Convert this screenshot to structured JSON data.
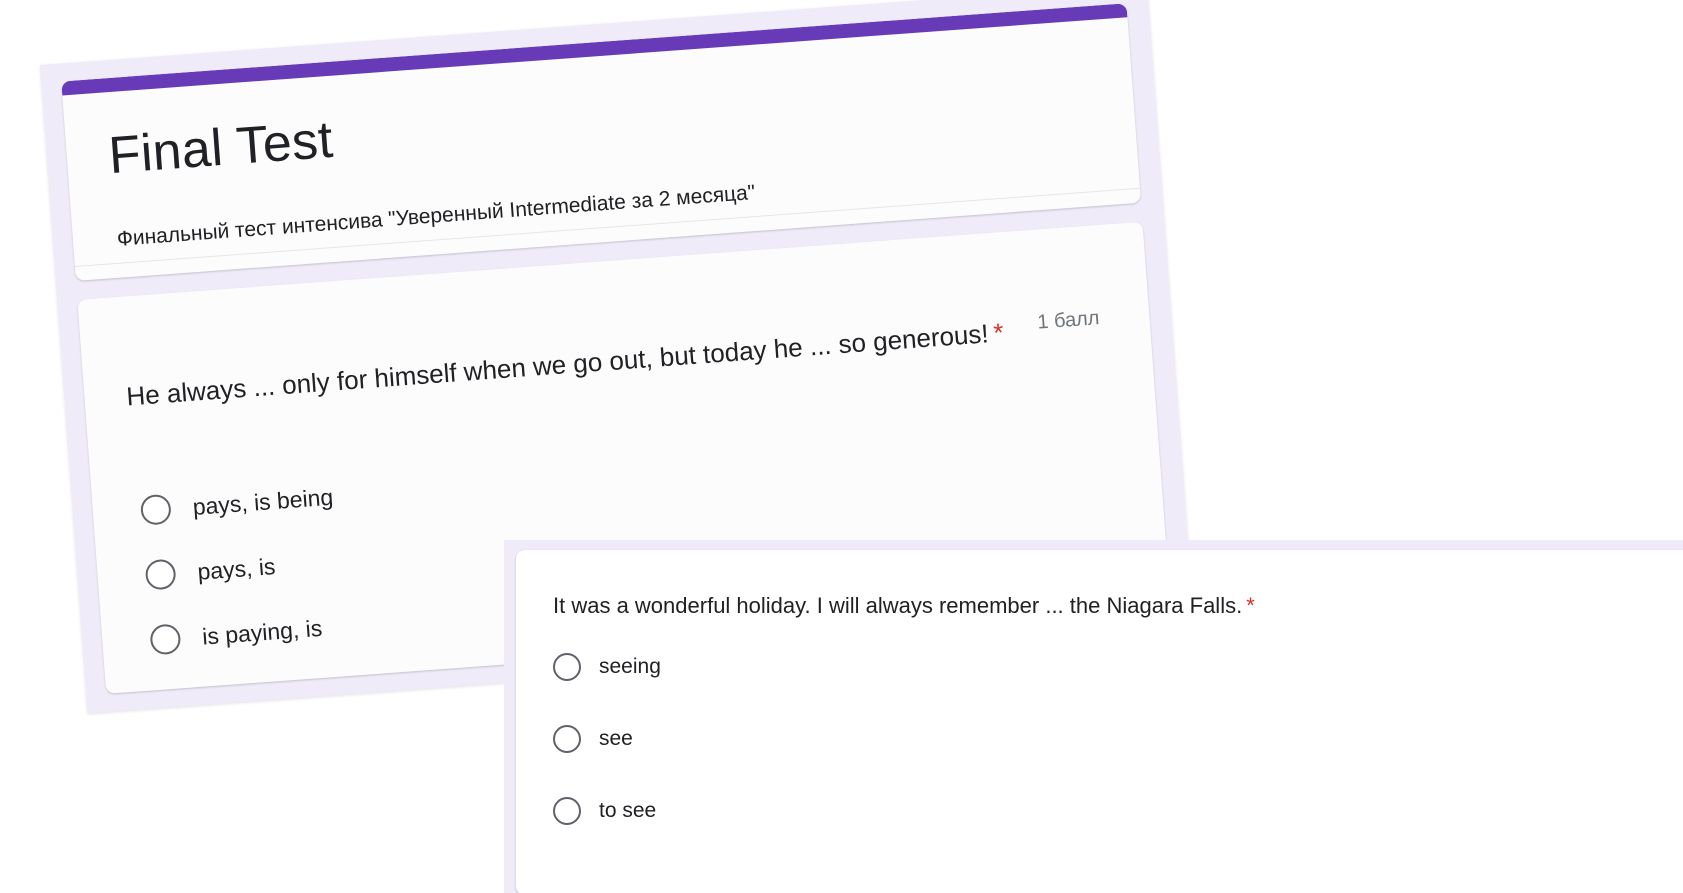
{
  "form": {
    "title": "Final Test",
    "description": "Финальный тест интенсива \"Уверенный Intermediate за 2 месяца\"",
    "accent_color": "#673ab7",
    "background_color": "#f0ebf8"
  },
  "question1": {
    "text": "He always ... only for himself when we go out, but today he ... so generous!",
    "required_mark": "*",
    "points": "1 балл",
    "options": [
      {
        "label": "pays, is being"
      },
      {
        "label": "pays, is"
      },
      {
        "label": "is paying, is"
      }
    ]
  },
  "question2": {
    "text": "It was a wonderful holiday. I will always remember ... the Niagara Falls.",
    "required_mark": "*",
    "options": [
      {
        "label": "seeing"
      },
      {
        "label": "see"
      },
      {
        "label": "to see"
      }
    ]
  },
  "colors": {
    "required": "#d93025",
    "text": "#202124",
    "muted": "#70757a"
  }
}
